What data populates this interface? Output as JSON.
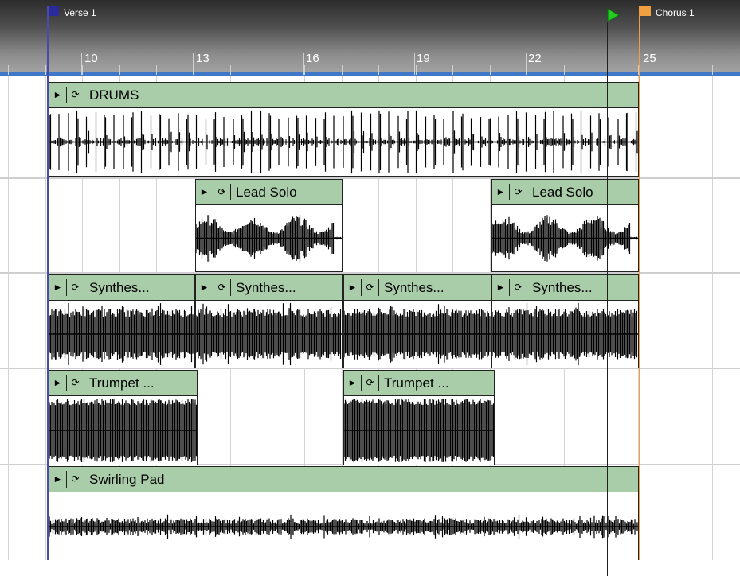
{
  "ruler": {
    "bars": [
      "10",
      "13",
      "16",
      "19",
      "22",
      "25"
    ],
    "markers": [
      {
        "label": "Verse 1",
        "color": "#3a3a9a"
      },
      {
        "label": "Chorus 1",
        "color": "#f0a040"
      }
    ],
    "playhead_color": "#22cc22",
    "ruler_line_color": "#3f78c8"
  },
  "tracks": [
    {
      "clips": [
        {
          "name": "DRUMS",
          "play_icon": "play-icon",
          "loop_icon": "loop-icon"
        }
      ]
    },
    {
      "clips": [
        {
          "name": "Lead Solo",
          "play_icon": "play-icon",
          "loop_icon": "loop-icon"
        },
        {
          "name": "Lead Solo",
          "play_icon": "play-icon",
          "loop_icon": "loop-icon"
        }
      ]
    },
    {
      "clips": [
        {
          "name": "Synthes...",
          "play_icon": "play-icon",
          "loop_icon": "loop-icon"
        },
        {
          "name": "Synthes...",
          "play_icon": "play-icon",
          "loop_icon": "loop-icon"
        },
        {
          "name": "Synthes...",
          "play_icon": "play-icon",
          "loop_icon": "loop-icon"
        },
        {
          "name": "Synthes...",
          "play_icon": "play-icon",
          "loop_icon": "loop-icon"
        }
      ]
    },
    {
      "clips": [
        {
          "name": "Trumpet ...",
          "play_icon": "play-icon",
          "loop_icon": "loop-icon"
        },
        {
          "name": "Trumpet ...",
          "play_icon": "play-icon",
          "loop_icon": "loop-icon"
        }
      ]
    },
    {
      "clips": [
        {
          "name": "Swirling Pad",
          "play_icon": "play-icon",
          "loop_icon": "loop-icon"
        }
      ]
    }
  ],
  "colors": {
    "clip_header": "#a9cca9",
    "waveform": "#000000",
    "grid": "#d4d4d4"
  }
}
